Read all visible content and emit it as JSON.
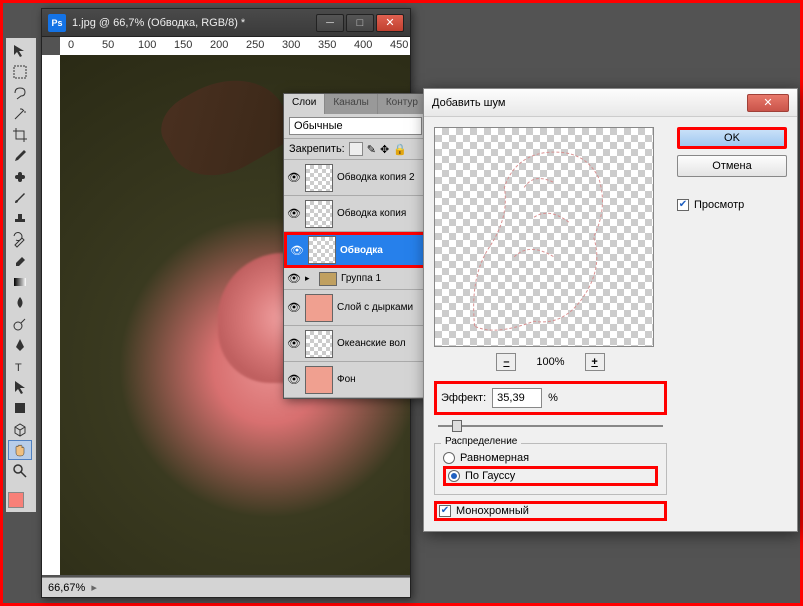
{
  "document": {
    "title": "1.jpg @ 66,7% (Обводка, RGB/8) *",
    "zoom_status": "66,67%",
    "ruler_marks": [
      "0",
      "50",
      "100",
      "150",
      "200",
      "250",
      "300",
      "350",
      "400",
      "450"
    ]
  },
  "layers_panel": {
    "tabs": [
      "Слои",
      "Каналы",
      "Контур"
    ],
    "blend_mode": "Обычные",
    "lock_label": "Закрепить:",
    "layers": [
      {
        "name": "Обводка копия 2",
        "visible": true,
        "thumb": "checker"
      },
      {
        "name": "Обводка копия",
        "visible": true,
        "thumb": "checker"
      },
      {
        "name": "Обводка",
        "visible": true,
        "active": true,
        "selected_hl": true,
        "thumb": "checker"
      },
      {
        "name": "Группа 1",
        "visible": true,
        "group": true
      },
      {
        "name": "Слой с дырками",
        "visible": true,
        "thumb": "filled"
      },
      {
        "name": "Океанские вол",
        "visible": true,
        "thumb": "checker"
      },
      {
        "name": "Фон",
        "visible": true,
        "thumb": "filled"
      }
    ]
  },
  "dialog": {
    "title": "Добавить шум",
    "ok_label": "OK",
    "cancel_label": "Отмена",
    "preview_label": "Просмотр",
    "preview_checked": true,
    "zoom_minus": "–",
    "zoom_value": "100%",
    "zoom_plus": "+",
    "effect_label": "Эффект:",
    "effect_value": "35,39",
    "effect_unit": "%",
    "distribution_legend": "Распределение",
    "dist_uniform": "Равномерная",
    "dist_gaussian": "По Гауссу",
    "dist_selected": "gaussian",
    "mono_label": "Монохромный",
    "mono_checked": true
  },
  "tools": [
    "move",
    "marquee",
    "lasso",
    "wand",
    "crop",
    "eyedropper",
    "heal",
    "brush",
    "stamp",
    "history-brush",
    "eraser",
    "gradient",
    "blur",
    "dodge",
    "pen",
    "type",
    "path-select",
    "shape",
    "hand",
    "zoom"
  ]
}
